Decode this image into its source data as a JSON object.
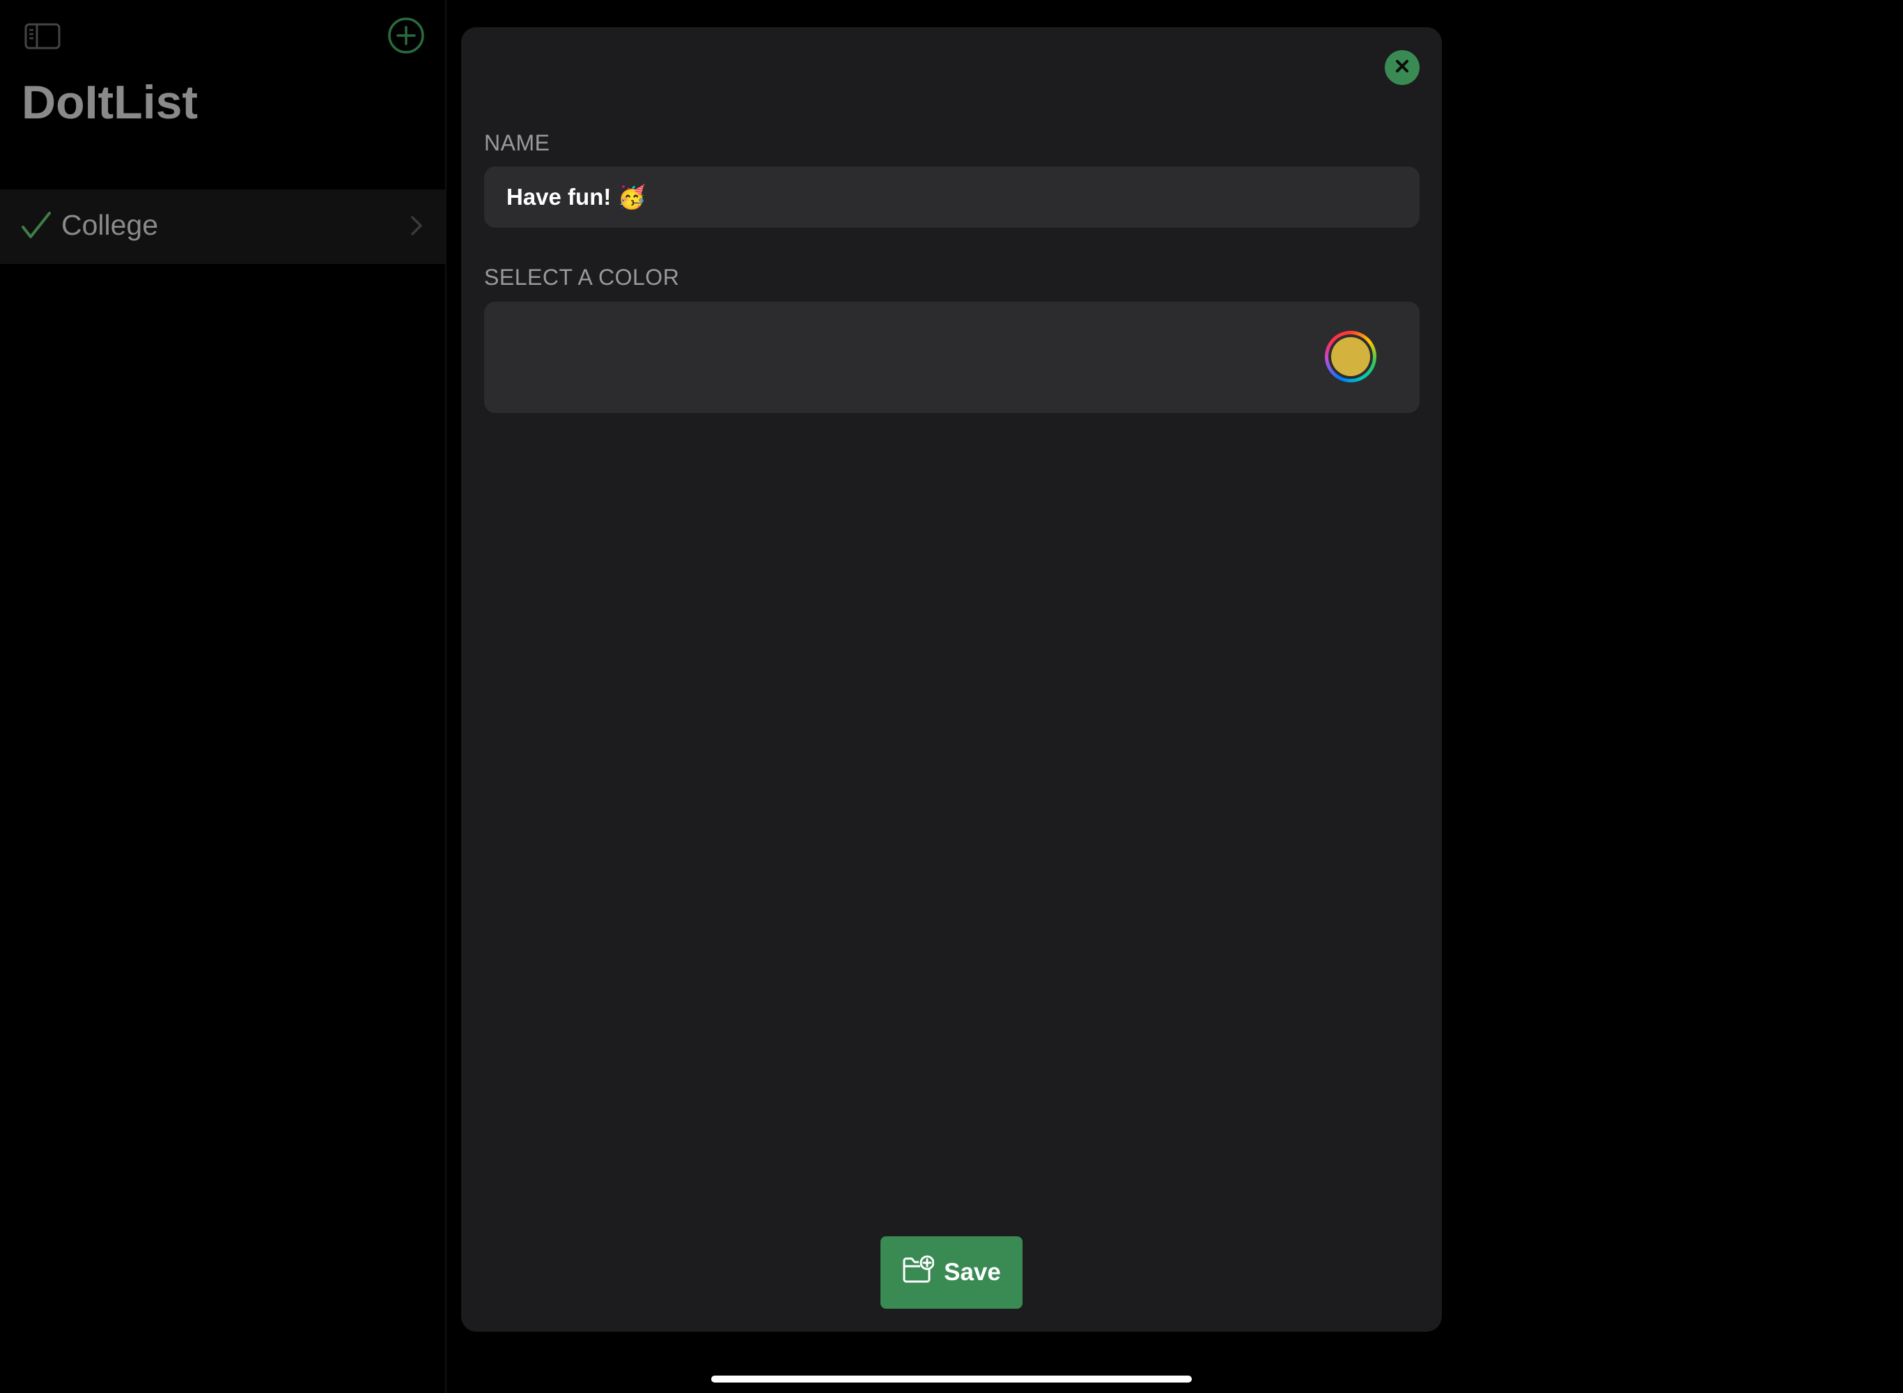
{
  "sidebar": {
    "title": "DoItList",
    "lists": [
      {
        "label": "College"
      }
    ]
  },
  "sheet": {
    "name_section_label": "NAME",
    "name_value": "Have fun! 🥳",
    "color_section_label": "SELECT A COLOR",
    "selected_color": "#d4b23e",
    "save_label": "Save"
  },
  "colors": {
    "accent": "#3a8a53",
    "sheet_bg": "#1c1c1e",
    "field_bg": "#2c2c2e"
  }
}
